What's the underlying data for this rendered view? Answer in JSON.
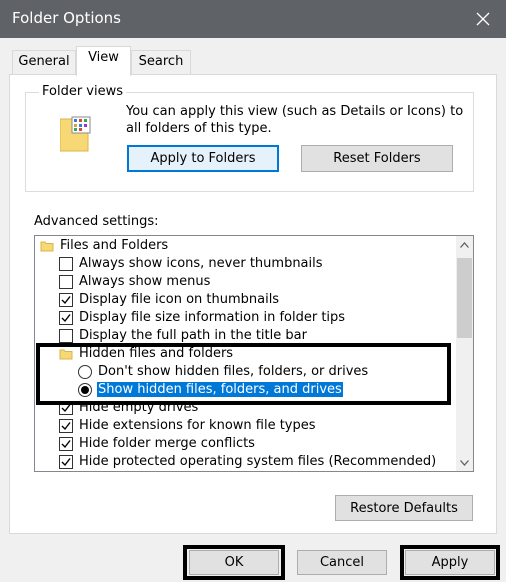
{
  "window": {
    "title": "Folder Options"
  },
  "tabs": [
    {
      "label": "General"
    },
    {
      "label": "View"
    },
    {
      "label": "Search"
    }
  ],
  "folder_views": {
    "legend": "Folder views",
    "description": "You can apply this view (such as Details or Icons) to all folders of this type.",
    "apply_button": "Apply to Folders",
    "reset_button": "Reset Folders"
  },
  "advanced": {
    "label": "Advanced settings:",
    "items": [
      {
        "type": "folder",
        "label": "Files and Folders"
      },
      {
        "type": "checkbox",
        "label": "Always show icons, never thumbnails",
        "checked": false
      },
      {
        "type": "checkbox",
        "label": "Always show menus",
        "checked": false
      },
      {
        "type": "checkbox",
        "label": "Display file icon on thumbnails",
        "checked": true
      },
      {
        "type": "checkbox",
        "label": "Display file size information in folder tips",
        "checked": true
      },
      {
        "type": "checkbox",
        "label": "Display the full path in the title bar",
        "checked": false
      },
      {
        "type": "folder",
        "label": "Hidden files and folders"
      },
      {
        "type": "radio",
        "label": "Don't show hidden files, folders, or drives",
        "checked": false
      },
      {
        "type": "radio",
        "label": "Show hidden files, folders, and drives",
        "checked": true
      },
      {
        "type": "checkbox",
        "label": "Hide empty drives",
        "checked": true
      },
      {
        "type": "checkbox",
        "label": "Hide extensions for known file types",
        "checked": true
      },
      {
        "type": "checkbox",
        "label": "Hide folder merge conflicts",
        "checked": true
      },
      {
        "type": "checkbox",
        "label": "Hide protected operating system files (Recommended)",
        "checked": true
      }
    ]
  },
  "buttons": {
    "restore": "Restore Defaults",
    "ok": "OK",
    "cancel": "Cancel",
    "apply": "Apply"
  },
  "colors": {
    "titlebar": "#5f6368",
    "selection": "#0078d7",
    "folder": "#f8d775"
  }
}
